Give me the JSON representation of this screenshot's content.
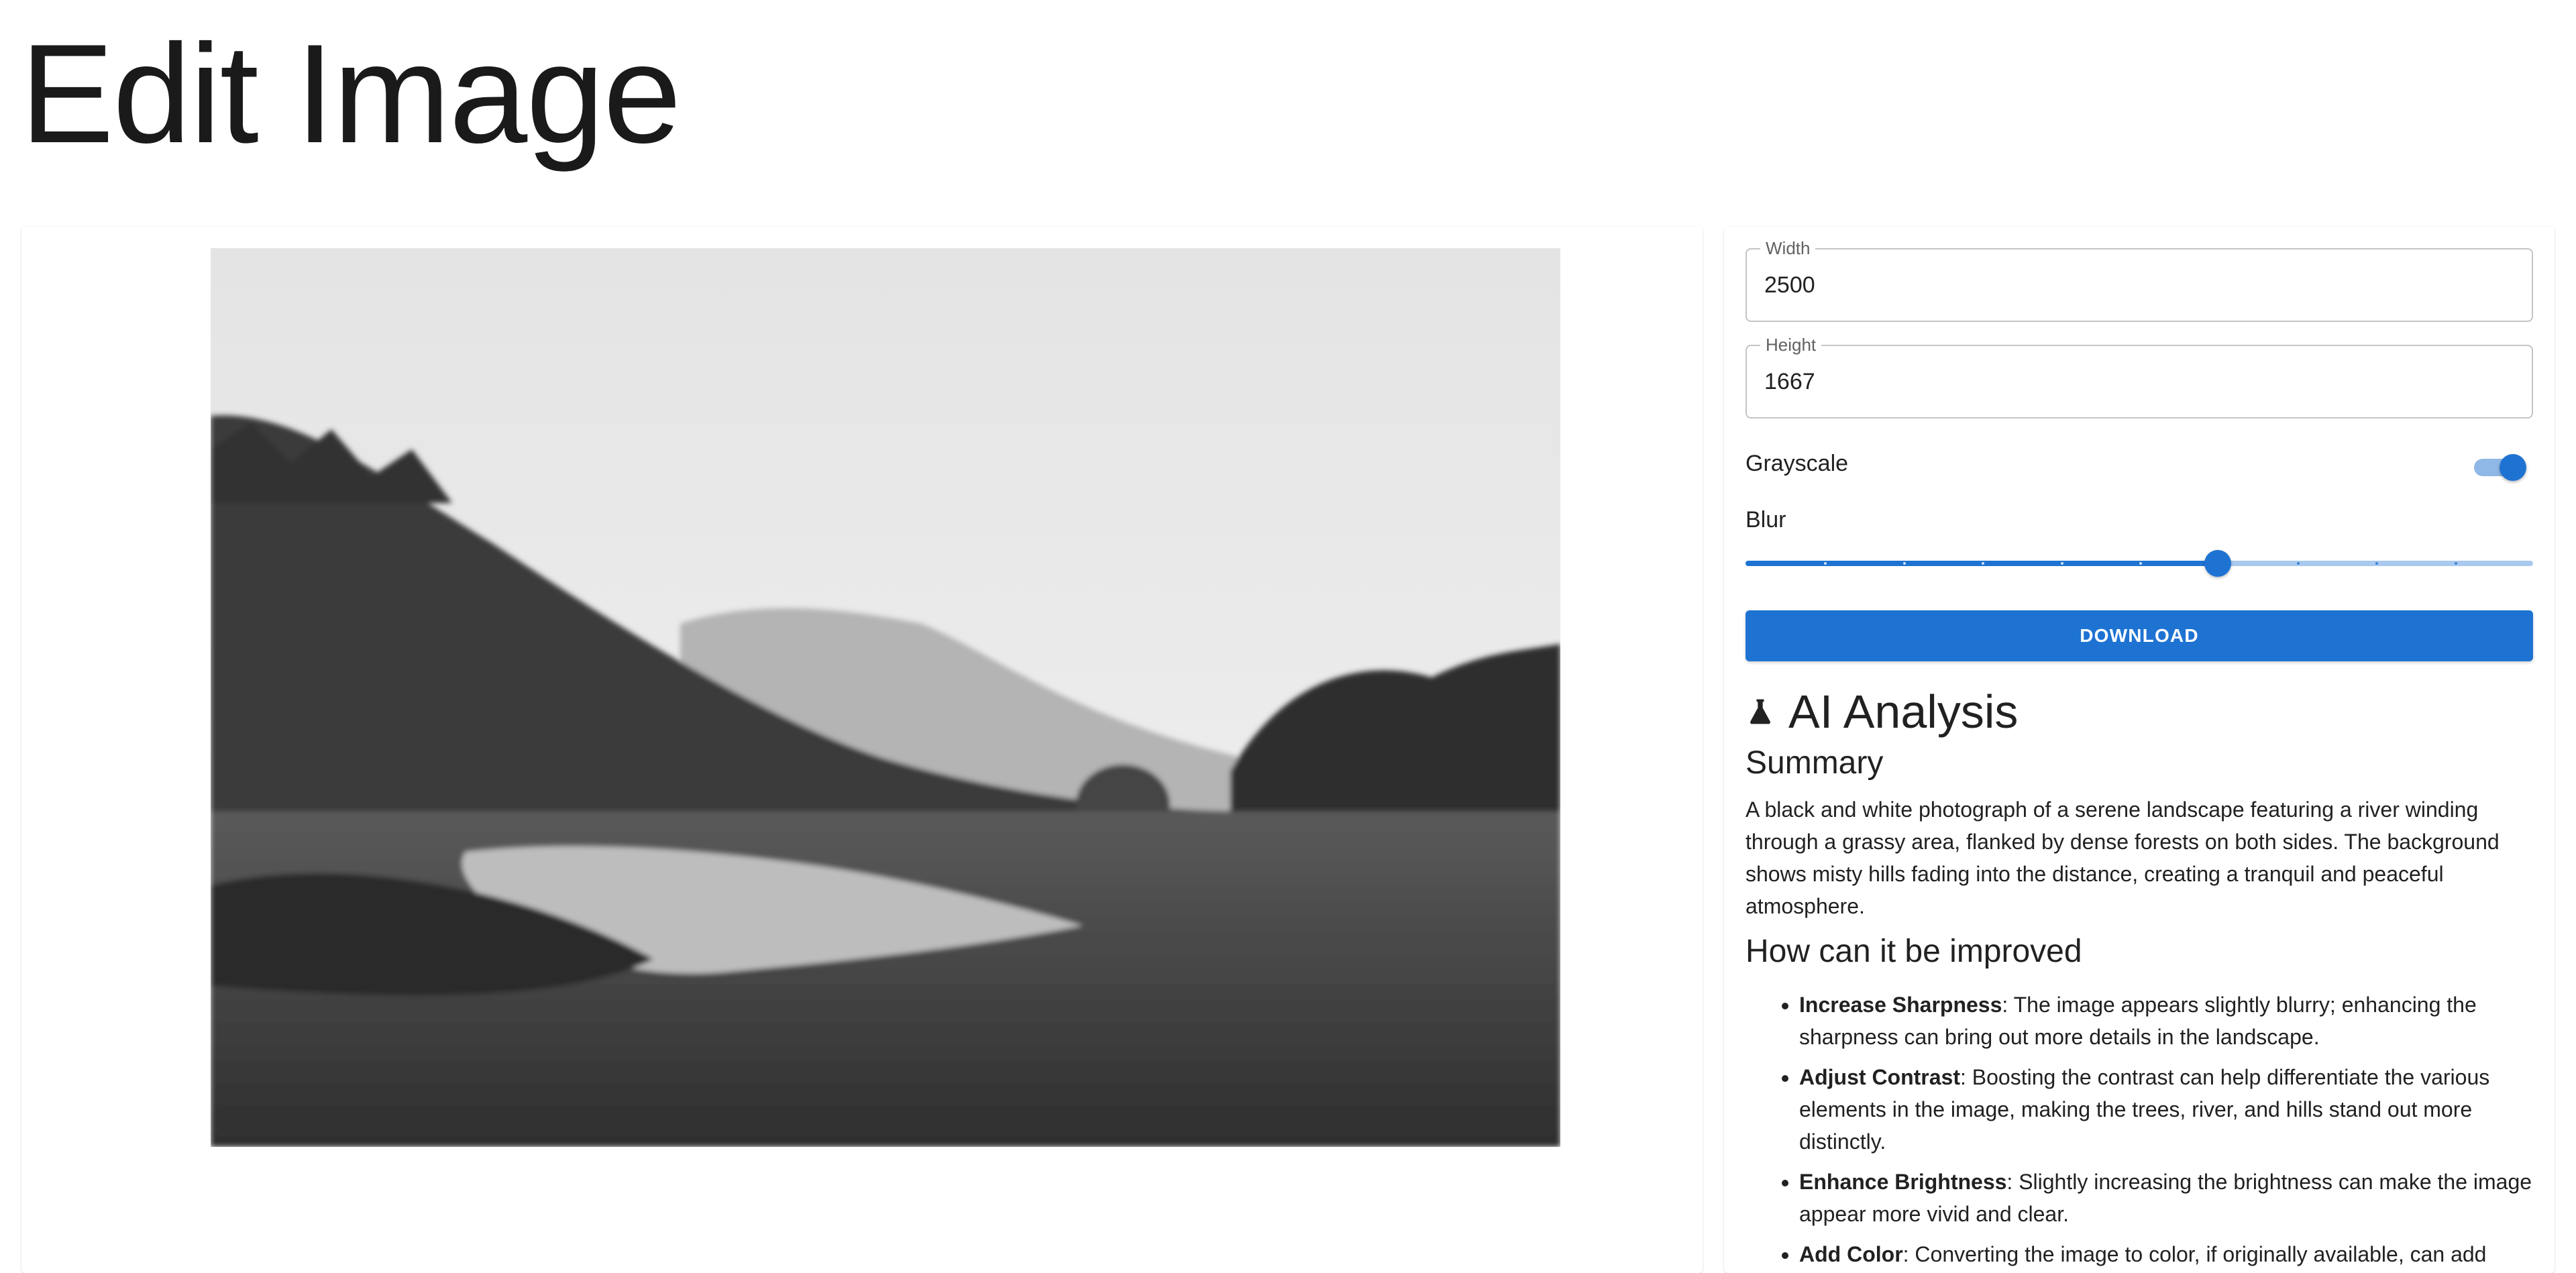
{
  "page": {
    "title": "Edit Image"
  },
  "controls": {
    "width": {
      "label": "Width",
      "value": "2500"
    },
    "height": {
      "label": "Height",
      "value": "1667"
    },
    "grayscale": {
      "label": "Grayscale",
      "enabled": true
    },
    "blur": {
      "label": "Blur",
      "value_fraction": 0.6,
      "steps": 10
    },
    "download_label": "DOWNLOAD"
  },
  "ai": {
    "icon": "flask-icon",
    "title": "AI Analysis",
    "summary_title": "Summary",
    "summary_text": "A black and white photograph of a serene landscape featuring a river winding through a grassy area, flanked by dense forests on both sides. The background shows misty hills fading into the distance, creating a tranquil and peaceful atmosphere.",
    "improve_title": "How can it be improved",
    "improvements": [
      {
        "name": "Increase Sharpness",
        "text": ": The image appears slightly blurry; enhancing the sharpness can bring out more details in the landscape."
      },
      {
        "name": "Adjust Contrast",
        "text": ": Boosting the contrast can help differentiate the various elements in the image, making the trees, river, and hills stand out more distinctly."
      },
      {
        "name": "Enhance Brightness",
        "text": ": Slightly increasing the brightness can make the image appear more vivid and clear."
      },
      {
        "name": "Add Color",
        "text": ": Converting the image to color, if originally available, can add"
      }
    ]
  },
  "colors": {
    "primary": "#1e73d2",
    "primary_light": "#a9c9ef"
  }
}
